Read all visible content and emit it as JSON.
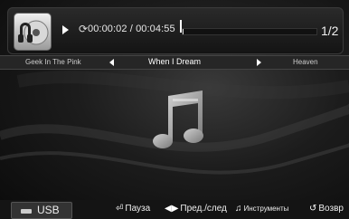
{
  "player": {
    "elapsed": "00:00:02",
    "total": "00:04:55",
    "time_separator": " / ",
    "progress_fraction": 0.01,
    "page_indicator": "1/2"
  },
  "tracks": {
    "previous": "Geek In The Pink",
    "current": "When I Dream",
    "next": "Heaven"
  },
  "icons": {
    "album": "album-cd-icon",
    "play": "play-icon",
    "repeat": "repeat-icon",
    "content": "music-note-icon",
    "source": "usb-drive-icon"
  },
  "bottom": {
    "source_label": "USB",
    "pause_label": "Пауза",
    "prevnext_label": "Пред./след",
    "tools_label": "Инструменты",
    "back_label": "Возвр"
  },
  "colors": {
    "background": "#1c1c1c",
    "text": "#ffffff",
    "accent": "#dddddd"
  }
}
